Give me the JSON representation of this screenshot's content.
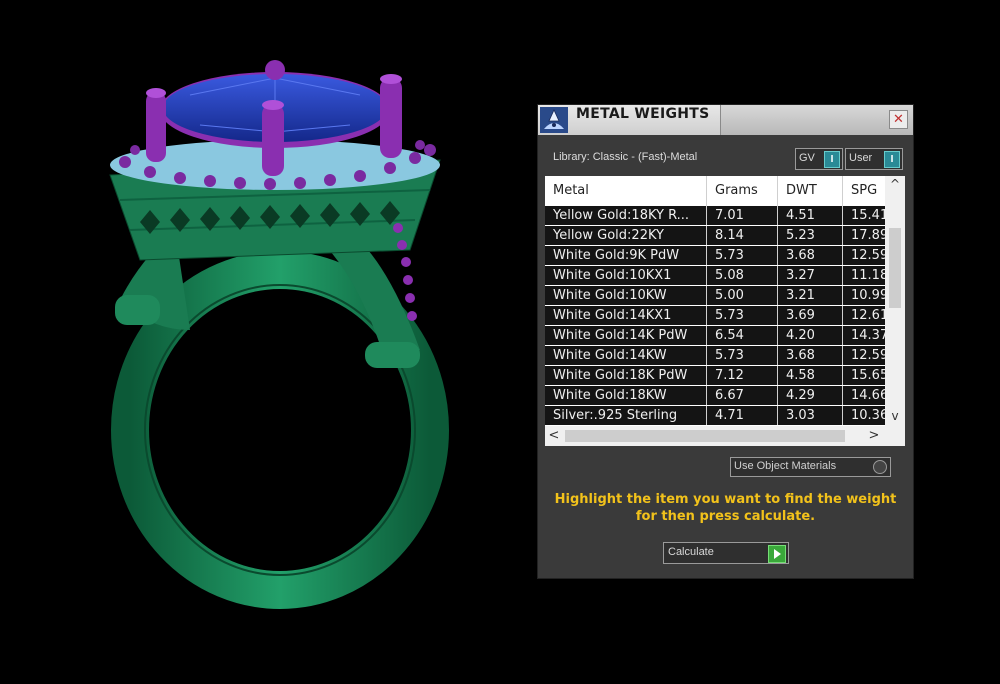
{
  "panel": {
    "title": "METAL WEIGHTS",
    "close_glyph": "✕",
    "library_label": "Library: Classic - (Fast)-Metal",
    "toggle_gv_label": "GV",
    "toggle_user_label": "User",
    "toggle_glyph": "I",
    "table": {
      "columns": [
        "Metal",
        "Grams",
        "DWT",
        "SPG"
      ],
      "rows": [
        [
          "Yellow Gold:18KY R...",
          "7.01",
          "4.51",
          "15.41"
        ],
        [
          "Yellow Gold:22KY",
          "8.14",
          "5.23",
          "17.89"
        ],
        [
          "White Gold:9K PdW",
          "5.73",
          "3.68",
          "12.59"
        ],
        [
          "White Gold:10KX1",
          "5.08",
          "3.27",
          "11.18"
        ],
        [
          "White Gold:10KW",
          "5.00",
          "3.21",
          "10.99"
        ],
        [
          "White Gold:14KX1",
          "5.73",
          "3.69",
          "12.61"
        ],
        [
          "White Gold:14K PdW",
          "6.54",
          "4.20",
          "14.37"
        ],
        [
          "White Gold:14KW",
          "5.73",
          "3.68",
          "12.59"
        ],
        [
          "White Gold:18K PdW",
          "7.12",
          "4.58",
          "15.65"
        ],
        [
          "White Gold:18KW",
          "6.67",
          "4.29",
          "14.66"
        ],
        [
          "Silver:.925 Sterling",
          "4.71",
          "3.03",
          "10.36"
        ]
      ]
    },
    "scroll_up": "^",
    "scroll_down": "v",
    "scroll_left": "<",
    "scroll_right": ">",
    "use_object_materials_label": "Use Object Materials",
    "hint_line1": "Highlight the item you want to find the weight",
    "hint_line2": "for then press calculate.",
    "calculate_label": "Calculate"
  },
  "colors": {
    "ring_metal": "#1f8a5c",
    "ring_metal_dark": "#0f5a3a",
    "prongs": "#8a2fb0",
    "gem": "#1f3fb8",
    "accent_stones": "#9fd8f0",
    "hint": "#f2c21b"
  },
  "icons": {
    "logo": "jeweler-logo-icon",
    "close": "close-icon",
    "toggle": "toggle-switch-icon",
    "play": "play-icon"
  }
}
